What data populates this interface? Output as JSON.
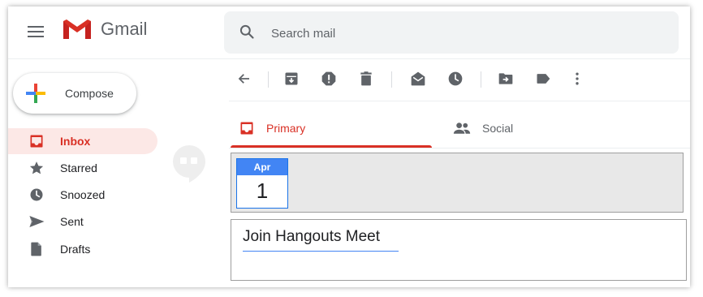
{
  "app": {
    "name": "Gmail"
  },
  "search": {
    "placeholder": "Search mail"
  },
  "compose": {
    "label": "Compose"
  },
  "sidebar": {
    "items": [
      {
        "label": "Inbox",
        "icon": "inbox-icon",
        "active": true
      },
      {
        "label": "Starred",
        "icon": "star-icon"
      },
      {
        "label": "Snoozed",
        "icon": "clock-icon"
      },
      {
        "label": "Sent",
        "icon": "send-icon"
      },
      {
        "label": "Drafts",
        "icon": "draft-icon"
      }
    ]
  },
  "toolbar": {
    "icons": [
      "back-arrow-icon",
      "archive-icon",
      "report-spam-icon",
      "delete-icon",
      "mark-unread-icon",
      "snooze-icon",
      "move-to-icon",
      "label-icon",
      "more-vert-icon"
    ]
  },
  "tabs": [
    {
      "label": "Primary",
      "icon": "inbox-icon",
      "active": true
    },
    {
      "label": "Social",
      "icon": "people-icon"
    }
  ],
  "calendar": {
    "month": "Apr",
    "day": "1"
  },
  "event": {
    "title": "Join Hangouts Meet"
  },
  "colors": {
    "accent_red": "#d93025",
    "active_bg": "#fce8e6",
    "calendar_blue": "#4285f4",
    "icon_gray": "#5f6368"
  }
}
